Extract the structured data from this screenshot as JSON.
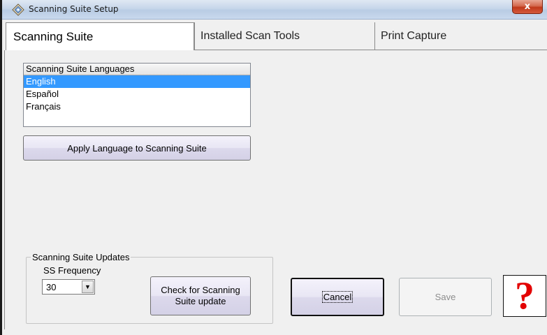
{
  "window": {
    "title": "Scanning Suite Setup",
    "close_label": "x"
  },
  "tabs": [
    {
      "label": "Scanning Suite"
    },
    {
      "label": "Installed Scan Tools"
    },
    {
      "label": "Print Capture"
    }
  ],
  "languages": {
    "header": "Scanning Suite Languages",
    "items": [
      "English",
      "Español",
      "Français"
    ],
    "selected": "English"
  },
  "apply_button": {
    "label": "Apply Language to Scanning Suite"
  },
  "updates": {
    "legend": "Scanning Suite Updates",
    "frequency_label": "SS Frequency",
    "frequency_value": "30",
    "check_label": "Check for Scanning Suite update"
  },
  "actions": {
    "cancel_label": "Cancel",
    "save_label": "Save",
    "help_label": "?"
  },
  "colors": {
    "selection": "#3399ff",
    "help_accent": "#e30000"
  }
}
